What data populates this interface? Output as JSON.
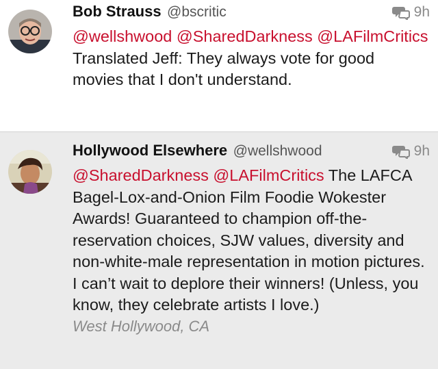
{
  "tweets": [
    {
      "author_name": "Bob Strauss",
      "handle": "@bscritic",
      "time": "9h",
      "mentions": [
        "@wellshwood",
        "@SharedDarkness",
        "@LAFilmCritics"
      ],
      "text": "Translated Jeff: They always vote for good movies that I don't understand."
    },
    {
      "author_name": "Hollywood Elsewhere",
      "handle": "@wellshwood",
      "time": "9h",
      "mentions": [
        "@SharedDarkness",
        "@LAFilmCritics"
      ],
      "text": "The LAFCA Bagel-Lox-and-Onion Film Foodie Wokester Awards!  Guaranteed to champion off-the-reservation choices, SJW values, diversity and non-white-male representation in motion pictures.  I can’t wait to deplore their winners!  (Unless, you know, they celebrate artists I love.)",
      "location": "West Hollywood, CA"
    }
  ],
  "icons": {
    "conversation": "conversation-icon"
  },
  "colors": {
    "mention": "#c8102e",
    "meta": "#8a8a8a",
    "second_bg": "#ebebeb"
  }
}
